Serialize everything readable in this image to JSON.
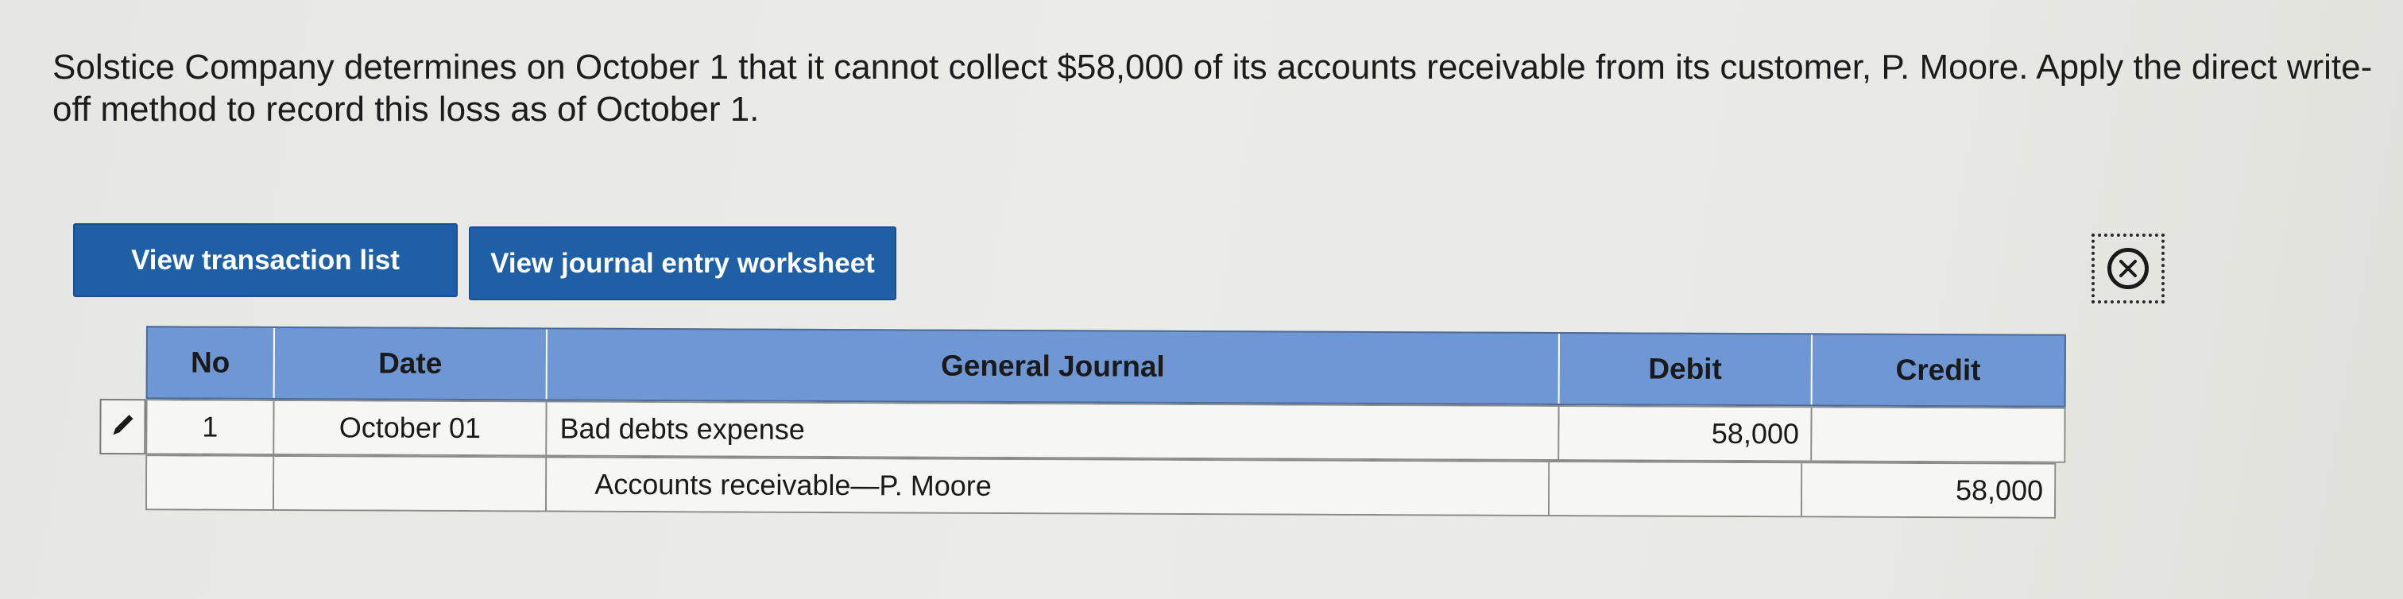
{
  "question": {
    "text": "Solstice Company determines on October 1 that it cannot collect $58,000 of its accounts receivable from its customer, P. Moore. Apply the direct write-off method to record this loss as of October 1."
  },
  "buttons": {
    "view_transaction_list": "View transaction list",
    "view_journal_entry_worksheet": "View journal entry worksheet"
  },
  "close_icon": "circle-x-icon",
  "journal": {
    "headers": {
      "no": "No",
      "date": "Date",
      "general_journal": "General Journal",
      "debit": "Debit",
      "credit": "Credit"
    },
    "rows": [
      {
        "no": "1",
        "date": "October 01",
        "account": "Bad debts expense",
        "debit": "58,000",
        "credit": ""
      },
      {
        "no": "",
        "date": "",
        "account": "Accounts receivable—P. Moore",
        "debit": "",
        "credit": "58,000"
      }
    ]
  },
  "colors": {
    "button_blue": "#1f5fa6",
    "header_blue": "#6e97d3"
  }
}
